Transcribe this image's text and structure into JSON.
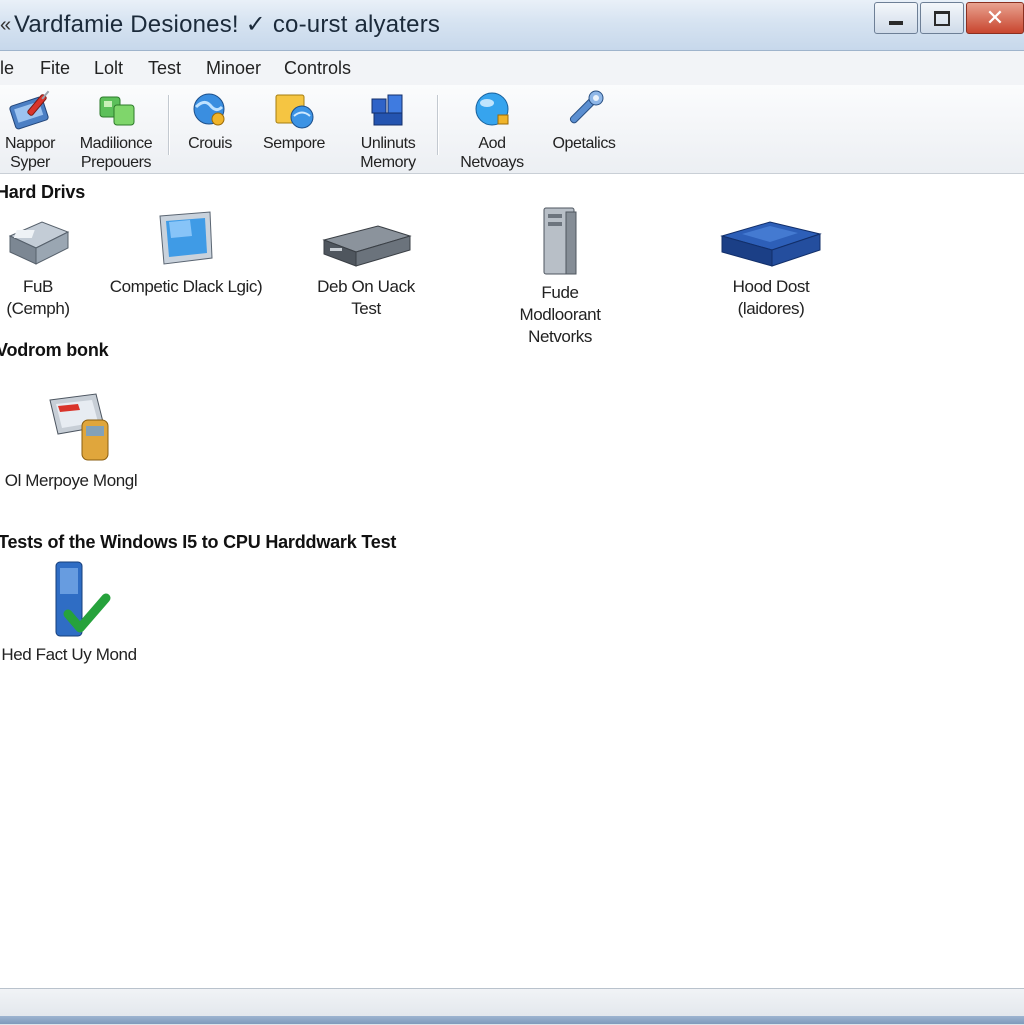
{
  "window": {
    "title_icon": "«",
    "title": "Vardfamie Desiones! ✓ co-urst alyaters",
    "controls": {
      "minimize": "minimize-icon",
      "maximize": "maximize-icon",
      "close": "✕"
    }
  },
  "menu": [
    "le",
    "Fite",
    "Lolt",
    "Test",
    "Minoer",
    "Controls"
  ],
  "toolbar": {
    "items": [
      {
        "line1": "Nappor",
        "line2": "Syper",
        "icon": "screwdriver-card-icon"
      },
      {
        "line1": "Madilionce",
        "line2": "Prepouers",
        "icon": "green-blocks-icon"
      },
      {
        "line1": "Crouis",
        "line2": "",
        "icon": "globe-icon"
      },
      {
        "line1": "Sempore",
        "line2": "",
        "icon": "folder-globe-icon"
      },
      {
        "line1": "Unlinuts",
        "line2": "Memory",
        "icon": "blue-cubes-icon"
      },
      {
        "line1": "Aod",
        "line2": "Netvoays",
        "icon": "network-globe-icon"
      },
      {
        "line1": "Opetalics",
        "line2": "",
        "icon": "wrench-icon"
      }
    ]
  },
  "sections": {
    "hard_drives": {
      "title": "Hard Drivs",
      "items": [
        {
          "line1": "FuB",
          "line2": "(Cemph)",
          "line3": "",
          "icon": "drive-icon"
        },
        {
          "line1": "Competic Dlack Lgic)",
          "line2": "",
          "line3": "",
          "icon": "monitor-icon"
        },
        {
          "line1": "Deb On Uack",
          "line2": "Test",
          "line3": "",
          "icon": "dvd-drive-icon"
        },
        {
          "line1": "Fude",
          "line2": "Modloorant",
          "line3": "Netvorks",
          "icon": "server-tower-icon"
        },
        {
          "line1": "Hood Dost",
          "line2": "(laidores)",
          "line3": "",
          "icon": "blue-disk-icon"
        }
      ]
    },
    "vodrom": {
      "title": "Vodrom bonk",
      "items": [
        {
          "line1": "Ol Merpoye Mongl",
          "icon": "device-package-icon"
        }
      ]
    },
    "tests": {
      "title": "Tests of the Windows I5 to CPU Harddwark Test",
      "items": [
        {
          "line1": "Hed Fact Uy Mond",
          "icon": "server-check-icon"
        }
      ]
    }
  }
}
